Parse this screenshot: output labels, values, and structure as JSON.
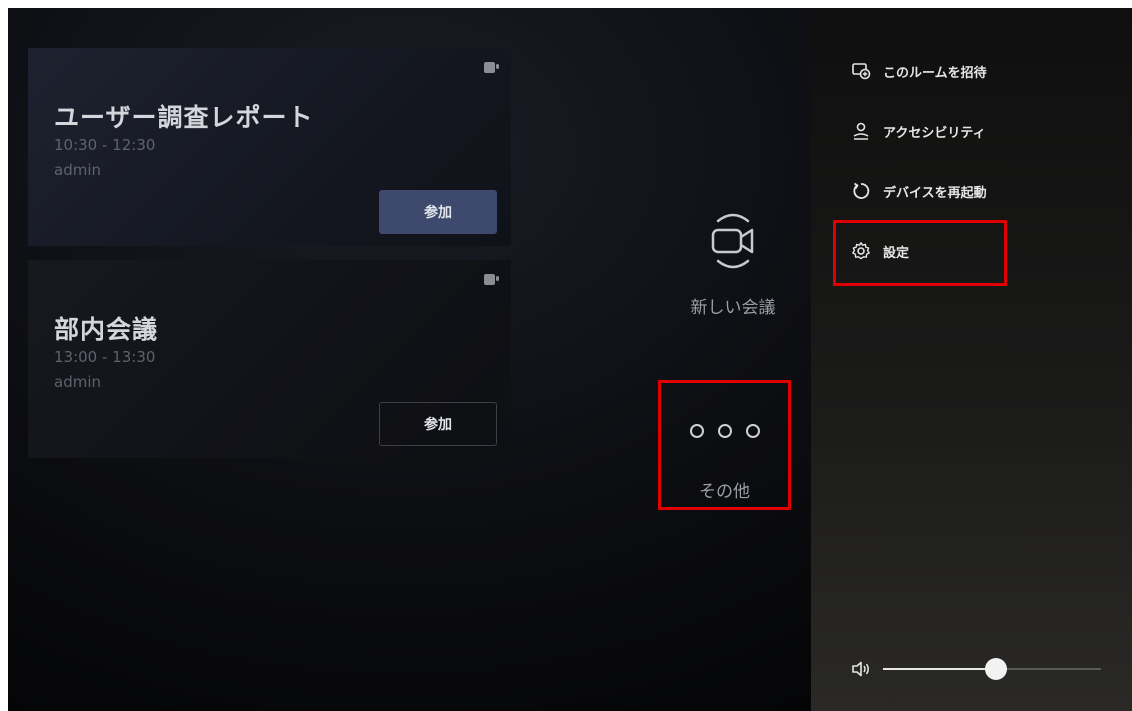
{
  "meetings": [
    {
      "title": "ユーザー調査レポート",
      "time": "10:30 - 12:30",
      "owner": "admin",
      "join_label": "参加"
    },
    {
      "title": "部内会議",
      "time": "13:00 - 13:30",
      "owner": "admin",
      "join_label": "参加"
    }
  ],
  "actions": {
    "new_meeting": "新しい会議",
    "more": "その他"
  },
  "menu": {
    "items": [
      {
        "label": "このルームを招待",
        "icon": "invite-icon"
      },
      {
        "label": "アクセシビリティ",
        "icon": "accessibility-icon"
      },
      {
        "label": "デバイスを再起動",
        "icon": "restart-icon"
      },
      {
        "label": "設定",
        "icon": "gear-icon"
      }
    ]
  },
  "volume": {
    "level": 0.52
  },
  "colors": {
    "highlight": "#e10000",
    "join_primary": "#3d4a6d"
  }
}
